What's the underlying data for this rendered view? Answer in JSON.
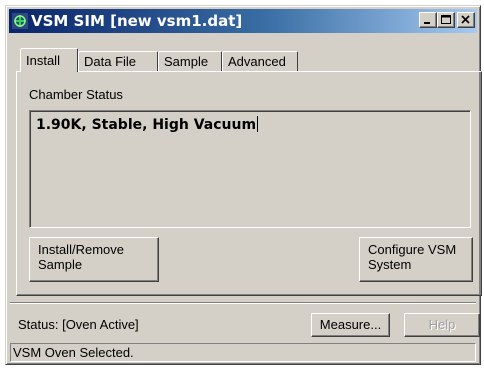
{
  "window": {
    "title": "VSM SIM [new vsm1.dat]"
  },
  "tabs": [
    {
      "label": "Install",
      "active": true
    },
    {
      "label": "Data File",
      "active": false
    },
    {
      "label": "Sample",
      "active": false
    },
    {
      "label": "Advanced",
      "active": false
    }
  ],
  "install_tab": {
    "group_label": "Chamber Status",
    "chamber_status_value": "1.90K, Stable, High Vacuum",
    "install_remove_button": {
      "line1": "Install/Remove",
      "line2": "Sample"
    },
    "configure_button": {
      "line1": "Configure VSM",
      "line2": "System"
    }
  },
  "footer": {
    "status_label": "Status: [Oven Active]",
    "measure_button": "Measure...",
    "help_button": "Help",
    "help_enabled": false
  },
  "statusbar": {
    "text": "VSM Oven Selected."
  },
  "colors": {
    "title_gradient_start": "#0a246a",
    "title_gradient_end": "#a6caf0",
    "face": "#d4d0c8"
  },
  "icons": [
    "vsm-app-icon",
    "minimize-icon",
    "maximize-icon",
    "close-icon"
  ]
}
